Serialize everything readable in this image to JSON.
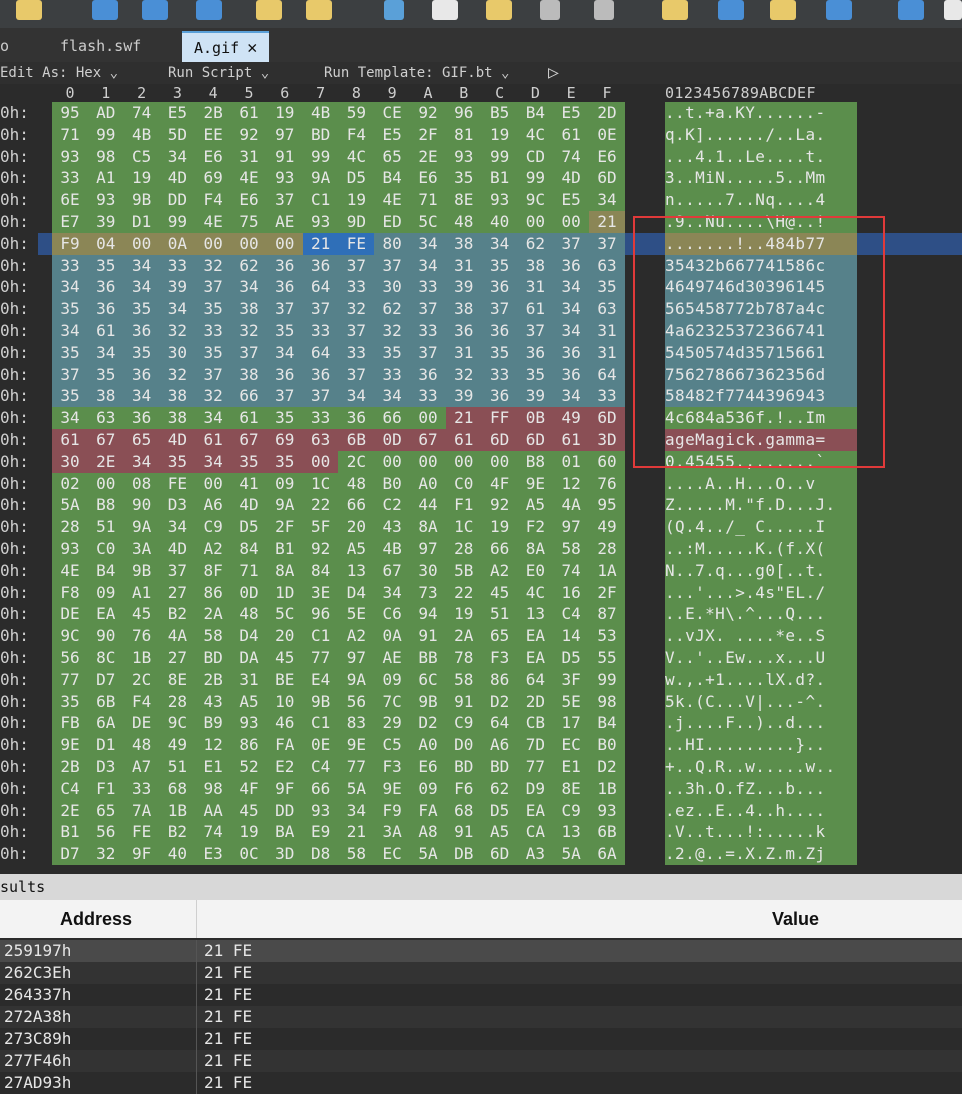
{
  "tabs": [
    "o",
    "flash.swf",
    "A.gif"
  ],
  "close_glyph": "✕",
  "editor_bar": {
    "edit_as": "Edit As: Hex",
    "run_script": "Run Script",
    "run_template": "Run Template: GIF.bt",
    "chev": "⌄",
    "play": "▷"
  },
  "column_header_hex": [
    "0",
    "1",
    "2",
    "3",
    "4",
    "5",
    "6",
    "7",
    "8",
    "9",
    "A",
    "B",
    "C",
    "D",
    "E",
    "F"
  ],
  "column_header_ascii": "0123456789ABCDEF",
  "rows": [
    {
      "addr": "0h:",
      "hex": [
        "95",
        "AD",
        "74",
        "E5",
        "2B",
        "61",
        "19",
        "4B",
        "59",
        "CE",
        "92",
        "96",
        "B5",
        "B4",
        "E5",
        "2D"
      ],
      "ascii": "..t.+a.KY......-"
    },
    {
      "addr": "0h:",
      "hex": [
        "71",
        "99",
        "4B",
        "5D",
        "EE",
        "92",
        "97",
        "BD",
        "F4",
        "E5",
        "2F",
        "81",
        "19",
        "4C",
        "61",
        "0E"
      ],
      "ascii": "q.K]....../..La."
    },
    {
      "addr": "0h:",
      "hex": [
        "93",
        "98",
        "C5",
        "34",
        "E6",
        "31",
        "91",
        "99",
        "4C",
        "65",
        "2E",
        "93",
        "99",
        "CD",
        "74",
        "E6"
      ],
      "ascii": "...4.1..Le....t."
    },
    {
      "addr": "0h:",
      "hex": [
        "33",
        "A1",
        "19",
        "4D",
        "69",
        "4E",
        "93",
        "9A",
        "D5",
        "B4",
        "E6",
        "35",
        "B1",
        "99",
        "4D",
        "6D"
      ],
      "ascii": "3..MiN.....5..Mm"
    },
    {
      "addr": "0h:",
      "hex": [
        "6E",
        "93",
        "9B",
        "DD",
        "F4",
        "E6",
        "37",
        "C1",
        "19",
        "4E",
        "71",
        "8E",
        "93",
        "9C",
        "E5",
        "34"
      ],
      "ascii": "n.....7..Nq....4"
    },
    {
      "addr": "0h:",
      "hex": [
        "E7",
        "39",
        "D1",
        "99",
        "4E",
        "75",
        "AE",
        "93",
        "9D",
        "ED",
        "5C",
        "48",
        "40",
        "00",
        "00",
        "21"
      ],
      "ascii": ".9..Nu....\\H@..!"
    },
    {
      "addr": "0h:",
      "hex": [
        "F9",
        "04",
        "00",
        "0A",
        "00",
        "00",
        "00",
        "21",
        "FE",
        "80",
        "34",
        "38",
        "34",
        "62",
        "37",
        "37"
      ],
      "ascii": ".......!..484b77"
    },
    {
      "addr": "0h:",
      "hex": [
        "33",
        "35",
        "34",
        "33",
        "32",
        "62",
        "36",
        "36",
        "37",
        "37",
        "34",
        "31",
        "35",
        "38",
        "36",
        "63"
      ],
      "ascii": "35432b667741586c"
    },
    {
      "addr": "0h:",
      "hex": [
        "34",
        "36",
        "34",
        "39",
        "37",
        "34",
        "36",
        "64",
        "33",
        "30",
        "33",
        "39",
        "36",
        "31",
        "34",
        "35"
      ],
      "ascii": "4649746d30396145"
    },
    {
      "addr": "0h:",
      "hex": [
        "35",
        "36",
        "35",
        "34",
        "35",
        "38",
        "37",
        "37",
        "32",
        "62",
        "37",
        "38",
        "37",
        "61",
        "34",
        "63"
      ],
      "ascii": "565458772b787a4c"
    },
    {
      "addr": "0h:",
      "hex": [
        "34",
        "61",
        "36",
        "32",
        "33",
        "32",
        "35",
        "33",
        "37",
        "32",
        "33",
        "36",
        "36",
        "37",
        "34",
        "31"
      ],
      "ascii": "4a62325372366741"
    },
    {
      "addr": "0h:",
      "hex": [
        "35",
        "34",
        "35",
        "30",
        "35",
        "37",
        "34",
        "64",
        "33",
        "35",
        "37",
        "31",
        "35",
        "36",
        "36",
        "31"
      ],
      "ascii": "5450574d35715661"
    },
    {
      "addr": "0h:",
      "hex": [
        "37",
        "35",
        "36",
        "32",
        "37",
        "38",
        "36",
        "36",
        "37",
        "33",
        "36",
        "32",
        "33",
        "35",
        "36",
        "64"
      ],
      "ascii": "756278667362356d"
    },
    {
      "addr": "0h:",
      "hex": [
        "35",
        "38",
        "34",
        "38",
        "32",
        "66",
        "37",
        "37",
        "34",
        "34",
        "33",
        "39",
        "36",
        "39",
        "34",
        "33"
      ],
      "ascii": "58482f7744396943"
    },
    {
      "addr": "0h:",
      "hex": [
        "34",
        "63",
        "36",
        "38",
        "34",
        "61",
        "35",
        "33",
        "36",
        "66",
        "00",
        "21",
        "FF",
        "0B",
        "49",
        "6D"
      ],
      "ascii": "4c684a536f.!..Im"
    },
    {
      "addr": "0h:",
      "hex": [
        "61",
        "67",
        "65",
        "4D",
        "61",
        "67",
        "69",
        "63",
        "6B",
        "0D",
        "67",
        "61",
        "6D",
        "6D",
        "61",
        "3D"
      ],
      "ascii": "ageMagick.gamma="
    },
    {
      "addr": "0h:",
      "hex": [
        "30",
        "2E",
        "34",
        "35",
        "34",
        "35",
        "35",
        "00",
        "2C",
        "00",
        "00",
        "00",
        "00",
        "B8",
        "01",
        "60"
      ],
      "ascii": "0.45455.,......`"
    },
    {
      "addr": "0h:",
      "hex": [
        "02",
        "00",
        "08",
        "FE",
        "00",
        "41",
        "09",
        "1C",
        "48",
        "B0",
        "A0",
        "C0",
        "4F",
        "9E",
        "12",
        "76"
      ],
      "ascii": "....A..H...O..v"
    },
    {
      "addr": "0h:",
      "hex": [
        "5A",
        "B8",
        "90",
        "D3",
        "A6",
        "4D",
        "9A",
        "22",
        "66",
        "C2",
        "44",
        "F1",
        "92",
        "A5",
        "4A",
        "95"
      ],
      "ascii": "Z.....M.\"f.D...J."
    },
    {
      "addr": "0h:",
      "hex": [
        "28",
        "51",
        "9A",
        "34",
        "C9",
        "D5",
        "2F",
        "5F",
        "20",
        "43",
        "8A",
        "1C",
        "19",
        "F2",
        "97",
        "49"
      ],
      "ascii": "(Q.4../_ C.....I"
    },
    {
      "addr": "0h:",
      "hex": [
        "93",
        "C0",
        "3A",
        "4D",
        "A2",
        "84",
        "B1",
        "92",
        "A5",
        "4B",
        "97",
        "28",
        "66",
        "8A",
        "58",
        "28"
      ],
      "ascii": "..:M.....K.(f.X("
    },
    {
      "addr": "0h:",
      "hex": [
        "4E",
        "B4",
        "9B",
        "37",
        "8F",
        "71",
        "8A",
        "84",
        "13",
        "67",
        "30",
        "5B",
        "A2",
        "E0",
        "74",
        "1A"
      ],
      "ascii": "N..7.q...g0[..t."
    },
    {
      "addr": "0h:",
      "hex": [
        "F8",
        "09",
        "A1",
        "27",
        "86",
        "0D",
        "1D",
        "3E",
        "D4",
        "34",
        "73",
        "22",
        "45",
        "4C",
        "16",
        "2F"
      ],
      "ascii": "...'...>.4s\"EL./"
    },
    {
      "addr": "0h:",
      "hex": [
        "DE",
        "EA",
        "45",
        "B2",
        "2A",
        "48",
        "5C",
        "96",
        "5E",
        "C6",
        "94",
        "19",
        "51",
        "13",
        "C4",
        "87"
      ],
      "ascii": "..E.*H\\.^...Q..."
    },
    {
      "addr": "0h:",
      "hex": [
        "9C",
        "90",
        "76",
        "4A",
        "58",
        "D4",
        "20",
        "C1",
        "A2",
        "0A",
        "91",
        "2A",
        "65",
        "EA",
        "14",
        "53"
      ],
      "ascii": "..vJX. ....*e..S"
    },
    {
      "addr": "0h:",
      "hex": [
        "56",
        "8C",
        "1B",
        "27",
        "BD",
        "DA",
        "45",
        "77",
        "97",
        "AE",
        "BB",
        "78",
        "F3",
        "EA",
        "D5",
        "55"
      ],
      "ascii": "V..'..Ew...x...U"
    },
    {
      "addr": "0h:",
      "hex": [
        "77",
        "D7",
        "2C",
        "8E",
        "2B",
        "31",
        "BE",
        "E4",
        "9A",
        "09",
        "6C",
        "58",
        "86",
        "64",
        "3F",
        "99"
      ],
      "ascii": "w.,.+1....lX.d?."
    },
    {
      "addr": "0h:",
      "hex": [
        "35",
        "6B",
        "F4",
        "28",
        "43",
        "A5",
        "10",
        "9B",
        "56",
        "7C",
        "9B",
        "91",
        "D2",
        "2D",
        "5E",
        "98"
      ],
      "ascii": "5k.(C...V|...-^."
    },
    {
      "addr": "0h:",
      "hex": [
        "FB",
        "6A",
        "DE",
        "9C",
        "B9",
        "93",
        "46",
        "C1",
        "83",
        "29",
        "D2",
        "C9",
        "64",
        "CB",
        "17",
        "B4"
      ],
      "ascii": ".j....F..)..d..."
    },
    {
      "addr": "0h:",
      "hex": [
        "9E",
        "D1",
        "48",
        "49",
        "12",
        "86",
        "FA",
        "0E",
        "9E",
        "C5",
        "A0",
        "D0",
        "A6",
        "7D",
        "EC",
        "B0"
      ],
      "ascii": "..HI.........}.."
    },
    {
      "addr": "0h:",
      "hex": [
        "2B",
        "D3",
        "A7",
        "51",
        "E1",
        "52",
        "E2",
        "C4",
        "77",
        "F3",
        "E6",
        "BD",
        "BD",
        "77",
        "E1",
        "D2"
      ],
      "ascii": "+..Q.R..w.....w.."
    },
    {
      "addr": "0h:",
      "hex": [
        "C4",
        "F1",
        "33",
        "68",
        "98",
        "4F",
        "9F",
        "66",
        "5A",
        "9E",
        "09",
        "F6",
        "62",
        "D9",
        "8E",
        "1B"
      ],
      "ascii": "..3h.O.fZ...b..."
    },
    {
      "addr": "0h:",
      "hex": [
        "2E",
        "65",
        "7A",
        "1B",
        "AA",
        "45",
        "DD",
        "93",
        "34",
        "F9",
        "FA",
        "68",
        "D5",
        "EA",
        "C9",
        "93"
      ],
      "ascii": ".ez..E..4..h...."
    },
    {
      "addr": "0h:",
      "hex": [
        "B1",
        "56",
        "FE",
        "B2",
        "74",
        "19",
        "BA",
        "E9",
        "21",
        "3A",
        "A8",
        "91",
        "A5",
        "CA",
        "13",
        "6B"
      ],
      "ascii": ".V..t...!:.....k"
    },
    {
      "addr": "0h:",
      "hex": [
        "D7",
        "32",
        "9F",
        "40",
        "E3",
        "0C",
        "3D",
        "D8",
        "58",
        "EC",
        "5A",
        "DB",
        "6D",
        "A3",
        "5A",
        "6A"
      ],
      "ascii": ".2.@..=.X.Z.m.Zj"
    }
  ],
  "results": {
    "title": "sults",
    "col_address": "Address",
    "col_value": "Value",
    "rows": [
      {
        "address": "259197h",
        "value": "21 FE"
      },
      {
        "address": "262C3Eh",
        "value": "21 FE"
      },
      {
        "address": "264337h",
        "value": "21 FE"
      },
      {
        "address": "272A38h",
        "value": "21 FE"
      },
      {
        "address": "273C89h",
        "value": "21 FE"
      },
      {
        "address": "277F46h",
        "value": "21 FE"
      },
      {
        "address": "27AD93h",
        "value": "21 FE"
      }
    ]
  },
  "colors": {
    "green": "#5b8e4c",
    "teal": "#56818a",
    "olive": "#8b8656",
    "red": "#8a4f55",
    "select": "#2f6fb8",
    "highlight_box": "#e03a3a"
  }
}
